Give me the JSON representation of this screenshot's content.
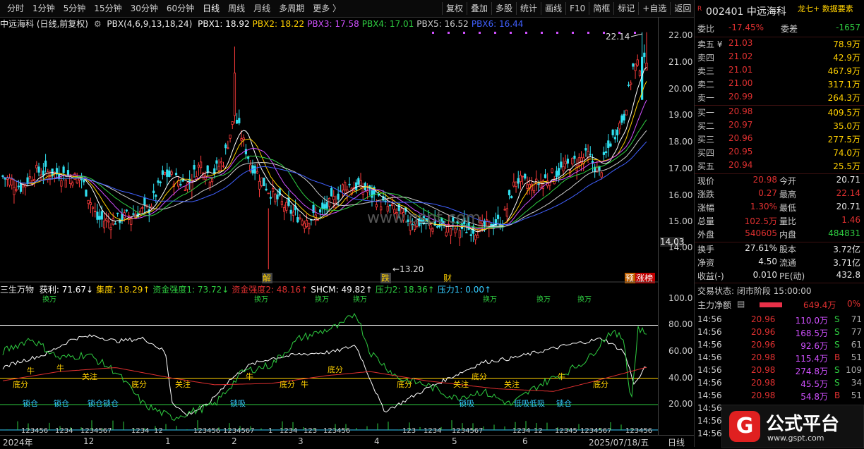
{
  "toolbar": {
    "periods": [
      "分时",
      "1分钟",
      "5分钟",
      "15分钟",
      "30分钟",
      "60分钟",
      "日线",
      "周线",
      "月线",
      "多周期",
      "更多 〉"
    ],
    "active": "日线",
    "buttons": [
      "复权",
      "叠加",
      "多股",
      "统计",
      "画线",
      "F10",
      "简框",
      "标记",
      "+自选",
      "返回"
    ]
  },
  "symbol": {
    "r_mark": "R",
    "code_name": "002401 中远海科",
    "tags": "龙七+ 数据要素"
  },
  "main_chart": {
    "title": "中远海科 (日线,前复权)",
    "indicator": "PBX(4,6,9,13,18,24)",
    "pbx": [
      {
        "label": "PBX1: 18.92",
        "color": "#ffffff"
      },
      {
        "label": "PBX2: 18.22",
        "color": "#ffd000"
      },
      {
        "label": "PBX3: 17.58",
        "color": "#d050ff"
      },
      {
        "label": "PBX4: 17.01",
        "color": "#2ecc40"
      },
      {
        "label": "PBX5: 16.52",
        "color": "#cccccc"
      },
      {
        "label": "PBX6: 16.44",
        "color": "#4060ff"
      }
    ],
    "price_axis": [
      "22.00",
      "21.00",
      "20.00",
      "19.00",
      "18.00",
      "17.00",
      "16.00",
      "15.00",
      "14.03",
      "14.00"
    ],
    "high_label": "22.14",
    "low_label": "13.20",
    "markers": [
      "解",
      "跌",
      "财",
      "预",
      "涨榜"
    ],
    "watermark": "www.gspt.com"
  },
  "sub_chart": {
    "title": "三生万物",
    "items": [
      {
        "label": "获利: 71.67↓",
        "color": "#ffffff"
      },
      {
        "label": "集度: 18.29↑",
        "color": "#ffd000"
      },
      {
        "label": "资金强度1: 73.72↓",
        "color": "#2ecc40"
      },
      {
        "label": "资金强度2: 48.16↑",
        "color": "#e03030"
      },
      {
        "label": "SHCM: 49.82↑",
        "color": "#ffffff"
      },
      {
        "label": "压力2: 18.36↑",
        "color": "#2ecc40"
      },
      {
        "label": "压力1: 0.00↑",
        "color": "#33ccff"
      }
    ],
    "axis": [
      "100.0",
      "80.00",
      "60.00",
      "40.00",
      "20.00"
    ],
    "signals": [
      "换万",
      "换万",
      "换万",
      "换万",
      "换万",
      "换万",
      "换万"
    ],
    "labels_yellow": [
      "牛",
      "牛",
      "关注",
      "底分",
      "底分",
      "关注",
      "牛",
      "底分",
      "牛",
      "底分",
      "底分",
      "关注",
      "底分",
      "关注",
      "牛",
      "底分"
    ],
    "labels_cyan": [
      "锁仓",
      "锁仓",
      "锁仓锁仓",
      "锁吸",
      "锁吸",
      "低吸低吸",
      "锁仓"
    ],
    "bottom_nums": [
      "123456",
      "1234",
      "1234567",
      "1234",
      "12",
      "123456",
      "1234567",
      "1",
      "1234",
      "123",
      "123456",
      "123",
      "1234",
      "1234567",
      "1234",
      "12",
      "12345",
      "1234567",
      "123456"
    ]
  },
  "dates": [
    "2024年",
    "12",
    "1",
    "2",
    "3",
    "4",
    "5",
    "6",
    "2025/07/18/五"
  ],
  "period_label": "日线",
  "quote": {
    "weibi": {
      "k": "委比",
      "v": "-17.45%",
      "k2": "委差",
      "v2": "-1657"
    },
    "sell": [
      {
        "k": "卖五 ¥",
        "p": "21.03",
        "q": "78.9万"
      },
      {
        "k": "卖四",
        "p": "21.02",
        "q": "42.9万"
      },
      {
        "k": "卖三",
        "p": "21.01",
        "q": "467.9万"
      },
      {
        "k": "卖二",
        "p": "21.00",
        "q": "317.1万"
      },
      {
        "k": "卖一",
        "p": "20.99",
        "q": "264.3万"
      }
    ],
    "buy": [
      {
        "k": "买一",
        "p": "20.98",
        "q": "409.5万"
      },
      {
        "k": "买二",
        "p": "20.97",
        "q": "35.0万"
      },
      {
        "k": "买三",
        "p": "20.96",
        "q": "277.5万"
      },
      {
        "k": "买四",
        "p": "20.95",
        "q": "74.0万"
      },
      {
        "k": "买五",
        "p": "20.94",
        "q": "25.5万"
      }
    ],
    "stats": [
      {
        "k": "现价",
        "v": "20.98",
        "k2": "今开",
        "v2": "20.71"
      },
      {
        "k": "涨跌",
        "v": "0.27",
        "k2": "最高",
        "v2": "22.14"
      },
      {
        "k": "涨幅",
        "v": "1.30%",
        "k2": "最低",
        "v2": "20.71"
      },
      {
        "k": "总量",
        "v": "102.5万",
        "k2": "量比",
        "v2": "1.46"
      },
      {
        "k": "外盘",
        "v": "540605",
        "k2": "内盘",
        "v2": "484831"
      }
    ],
    "stats2": [
      {
        "k": "换手",
        "v": "27.61%",
        "k2": "股本",
        "v2": "3.72亿"
      },
      {
        "k": "净资",
        "v": "4.50",
        "k2": "流通",
        "v2": "3.71亿"
      },
      {
        "k": "收益(-)",
        "v": "0.010",
        "k2": "PE(动)",
        "v2": "432.8"
      }
    ],
    "trade_state": "交易状态: 闭市阶段 15:00:00",
    "net_inflow": {
      "k": "主力净额",
      "v": "649.4万",
      "p": "0%"
    }
  },
  "ticks": [
    {
      "t": "14:56",
      "p": "20.96",
      "v": "110.0万",
      "s": "S",
      "n": "71"
    },
    {
      "t": "14:56",
      "p": "20.96",
      "v": "168.5万",
      "s": "S",
      "n": "77"
    },
    {
      "t": "14:56",
      "p": "20.96",
      "v": "92.6万",
      "s": "S",
      "n": "61"
    },
    {
      "t": "14:56",
      "p": "20.98",
      "v": "115.4万",
      "s": "B",
      "n": "51"
    },
    {
      "t": "14:56",
      "p": "20.98",
      "v": "274.8万",
      "s": "S",
      "n": "109"
    },
    {
      "t": "14:56",
      "p": "20.98",
      "v": "45.5万",
      "s": "S",
      "n": "34"
    },
    {
      "t": "14:56",
      "p": "20.98",
      "v": "54.8万",
      "s": "B",
      "n": "51"
    },
    {
      "t": "14:56",
      "p": "",
      "v": "",
      "s": "",
      "n": ""
    },
    {
      "t": "14:56",
      "p": "",
      "v": "",
      "s": "",
      "n": ""
    },
    {
      "t": "14:56",
      "p": "",
      "v": "",
      "s": "",
      "n": ""
    }
  ],
  "logo": {
    "g": "G",
    "t1": "公式平台",
    "t2": "www.gspt.com"
  }
}
